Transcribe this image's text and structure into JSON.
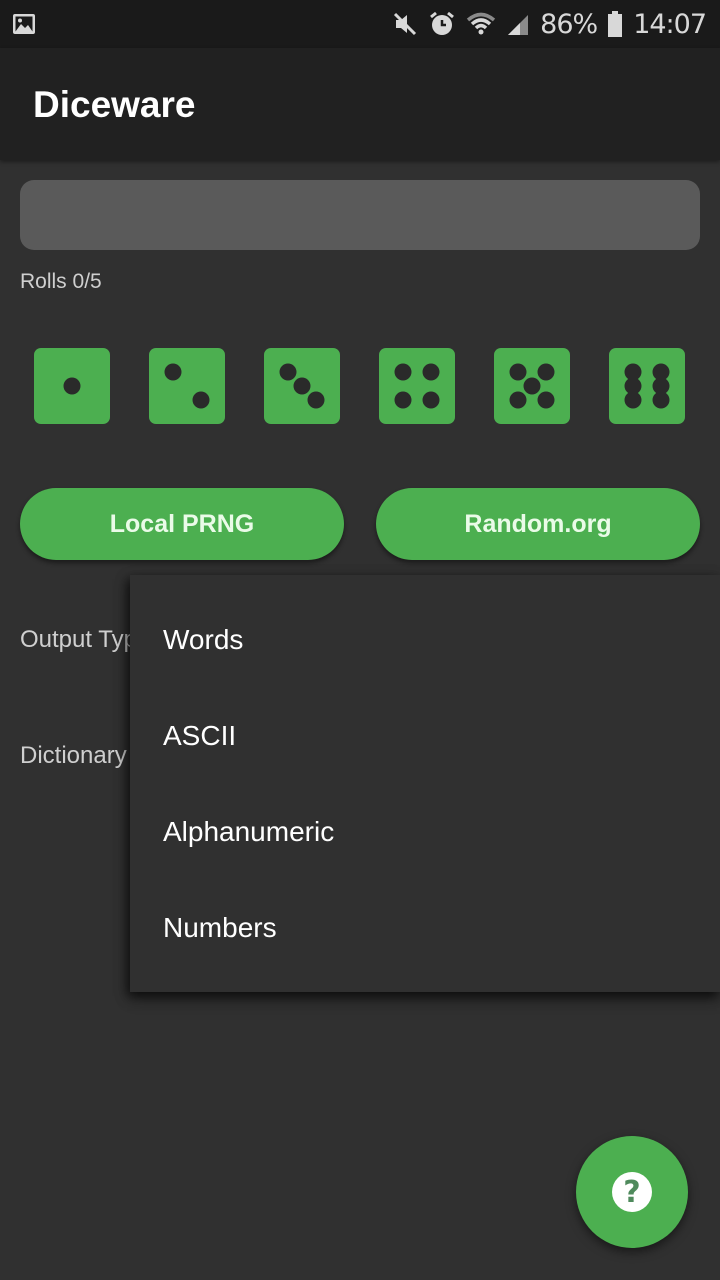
{
  "status_bar": {
    "left_icon": "image-notification-icon",
    "icons": [
      "mute-icon",
      "alarm-icon",
      "wifi-icon",
      "cell-signal-icon",
      "battery-icon"
    ],
    "battery_percent": "86%",
    "time": "14:07"
  },
  "app_bar": {
    "title": "Diceware"
  },
  "output": {
    "value": ""
  },
  "rolls": {
    "label": "Rolls 0/5",
    "current": 0,
    "total": 5
  },
  "dice": [
    {
      "face": 1,
      "icon": "die-face-1-icon"
    },
    {
      "face": 2,
      "icon": "die-face-2-icon"
    },
    {
      "face": 3,
      "icon": "die-face-3-icon"
    },
    {
      "face": 4,
      "icon": "die-face-4-icon"
    },
    {
      "face": 5,
      "icon": "die-face-5-icon"
    },
    {
      "face": 6,
      "icon": "die-face-6-icon"
    }
  ],
  "buttons": {
    "local_prng": "Local PRNG",
    "random_org": "Random.org"
  },
  "settings": {
    "output_type_label": "Output Type",
    "dictionary_label": "Dictionary"
  },
  "dropdown": {
    "options": [
      "Words",
      "ASCII",
      "Alphanumeric",
      "Numbers"
    ]
  },
  "fab": {
    "icon": "help-icon",
    "glyph": "?"
  },
  "colors": {
    "accent": "#4caf50",
    "background": "#303030",
    "app_bar": "#212121",
    "status_bar": "#1a1a1a",
    "output_field": "#5a5a5a",
    "pip": "#2a2a2a"
  }
}
